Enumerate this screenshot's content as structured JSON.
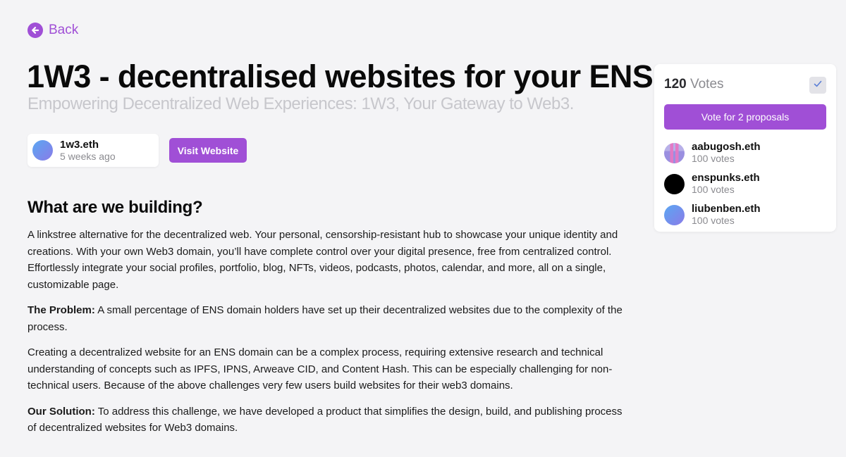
{
  "nav": {
    "back_label": "Back"
  },
  "proposal": {
    "title": "1W3 - decentralised websites for your ENS",
    "subtitle": "Empowering Decentralized Web Experiences: 1W3, Your Gateway to Web3.",
    "author": {
      "name": "1w3.eth",
      "time": "5 weeks ago"
    },
    "visit_label": "Visit Website"
  },
  "body": {
    "heading": "What are we building?",
    "intro": "A linkstree alternative for the decentralized web. Your personal, censorship-resistant hub to showcase your unique identity and creations. With your own Web3 domain, you’ll have complete control over your digital presence, free from centralized control. Effortlessly integrate your social profiles, portfolio, blog, NFTs, videos, podcasts, photos, calendar, and more, all on a single, customizable page.",
    "problem_label": "The Problem:",
    "problem_text": " A small percentage of ENS domain holders have set up their decentralized websites due to the complexity of the process.",
    "complexity": "Creating a decentralized website for an ENS domain can be a complex process, requiring extensive research and technical understanding of concepts such as IPFS, IPNS, Arweave CID, and Content Hash. This can be especially challenging for non-technical users. Because of the above challenges very few users build websites for their web3 domains.",
    "solution_label": "Our Solution:",
    "solution_text": " To address this challenge, we have developed a product that simplifies the design, build, and publishing process of decentralized websites for Web3 domains."
  },
  "votes": {
    "count": "120",
    "label": "Votes",
    "vote_button_label": "Vote for 2 proposals",
    "voters": [
      {
        "name": "aabugosh.eth",
        "votes": "100 votes",
        "avatar": "pixel"
      },
      {
        "name": "enspunks.eth",
        "votes": "100 votes",
        "avatar": "black"
      },
      {
        "name": "liubenben.eth",
        "votes": "100 votes",
        "avatar": "gradient"
      }
    ]
  },
  "colors": {
    "accent": "#a04fd6",
    "background": "#f4f4f6",
    "muted_text": "#8b8b90",
    "subtitle": "#c7c7cc",
    "check": "#5b7fd6"
  },
  "icons": {
    "back": "arrow-left-circle-icon",
    "vote_check": "checkmark-icon"
  }
}
